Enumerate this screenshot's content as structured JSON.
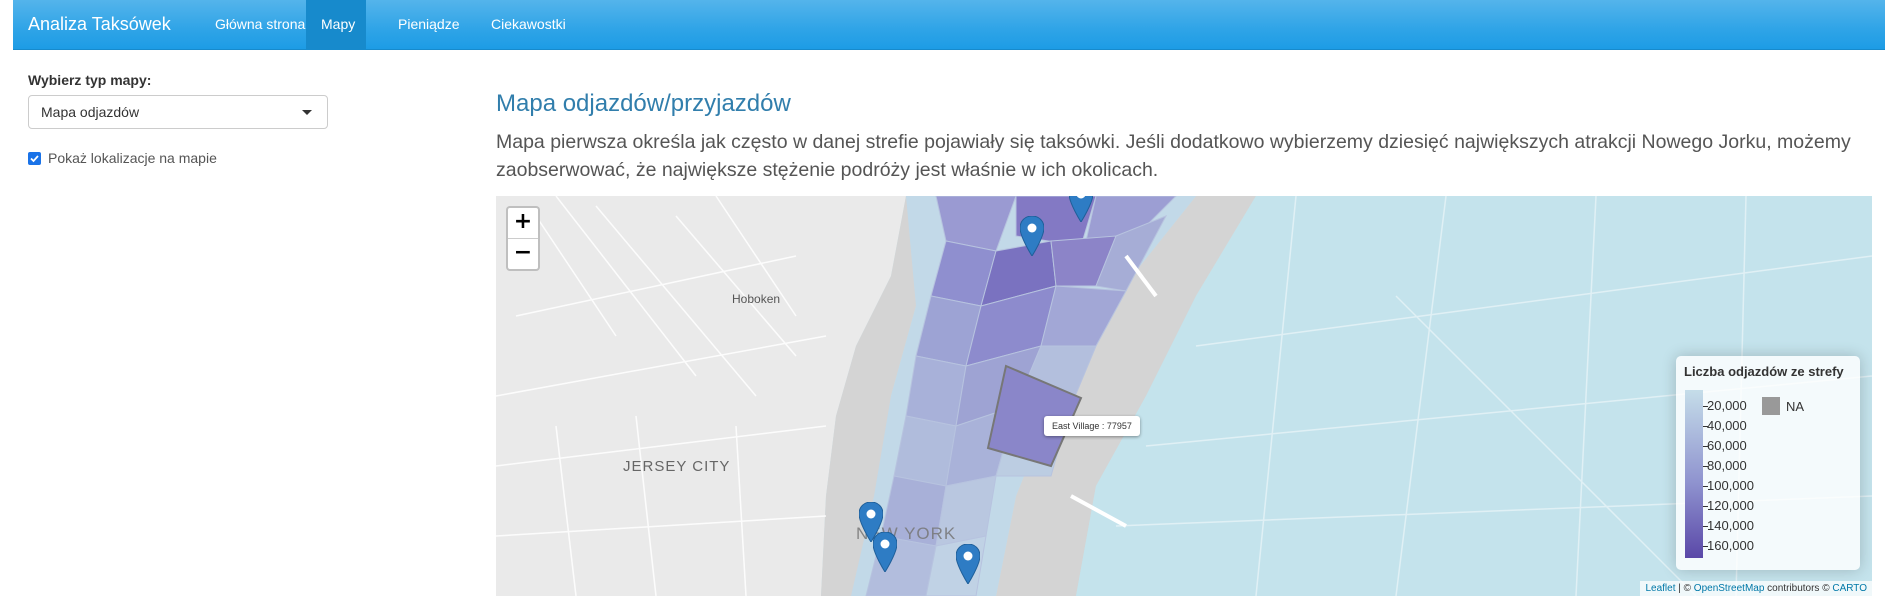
{
  "navbar": {
    "brand": "Analiza Taksówek",
    "items": [
      {
        "label": "Główna strona"
      },
      {
        "label": "Mapy"
      },
      {
        "label": "Pieniądze"
      },
      {
        "label": "Ciekawostki"
      }
    ]
  },
  "sidebar": {
    "select_label": "Wybierz typ mapy:",
    "select_value": "Mapa odjazdów",
    "checkbox_label": "Pokaż lokalizacje na mapie"
  },
  "main": {
    "title": "Mapa odjazdów/przyjazdów",
    "description": "Mapa pierwsza określa jak często w danej strefie pojawiały się taksówki. Jeśli dodatkowo wybierzemy dziesięć największych atrakcji Nowego Jorku, możemy zaobserwować, że największe stężenie podróży jest właśnie w ich okolicach."
  },
  "map": {
    "zoom_in": "+",
    "zoom_out": "−",
    "labels": {
      "hoboken": "Hoboken",
      "jersey_city": "JERSEY CITY",
      "new_york": "NEW YORK"
    },
    "tooltip": "East Village : 77957",
    "legend": {
      "title": "Liczba odjazdów ze strefy",
      "ticks": [
        "20,000",
        "40,000",
        "60,000",
        "80,000",
        "100,000",
        "120,000",
        "140,000",
        "160,000"
      ],
      "na_label": "NA"
    },
    "attribution": {
      "leaflet": "Leaflet",
      "sep1": " | © ",
      "osm": "OpenStreetMap",
      "contrib": " contributors © ",
      "carto": "CARTO"
    }
  }
}
